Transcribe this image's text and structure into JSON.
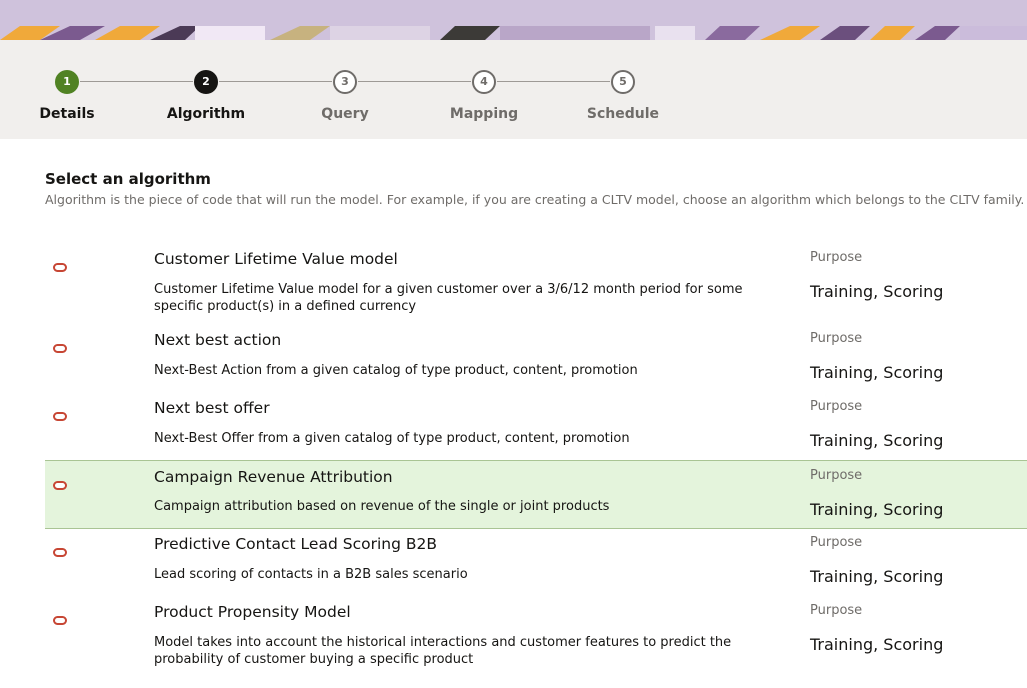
{
  "stepper": {
    "steps": [
      {
        "number": "1",
        "label": "Details",
        "state": "done"
      },
      {
        "number": "2",
        "label": "Algorithm",
        "state": "current"
      },
      {
        "number": "3",
        "label": "Query",
        "state": "pending"
      },
      {
        "number": "4",
        "label": "Mapping",
        "state": "pending"
      },
      {
        "number": "5",
        "label": "Schedule",
        "state": "pending"
      }
    ]
  },
  "section": {
    "title": "Select an algorithm",
    "description": "Algorithm is the piece of code that will run the model. For example, if you are creating a CLTV model, choose an algorithm which belongs to the CLTV family."
  },
  "algorithms": [
    {
      "name": "Customer Lifetime Value model",
      "description": "Customer Lifetime Value model for a given customer over a 3/6/12 month period for some specific product(s) in a defined currency",
      "purpose_label": "Purpose",
      "purpose": "Training, Scoring",
      "selected": false
    },
    {
      "name": "Next best action",
      "description": "Next-Best Action from a given catalog of type product, content, promotion",
      "purpose_label": "Purpose",
      "purpose": "Training, Scoring",
      "selected": false
    },
    {
      "name": "Next best offer",
      "description": "Next-Best Offer from a given catalog of type product, content, promotion",
      "purpose_label": "Purpose",
      "purpose": "Training, Scoring",
      "selected": false
    },
    {
      "name": "Campaign Revenue Attribution",
      "description": "Campaign attribution based on revenue of the single or joint products",
      "purpose_label": "Purpose",
      "purpose": "Training, Scoring",
      "selected": true
    },
    {
      "name": "Predictive Contact Lead Scoring B2B",
      "description": "Lead scoring of contacts in a B2B sales scenario",
      "purpose_label": "Purpose",
      "purpose": "Training, Scoring",
      "selected": false
    },
    {
      "name": "Product Propensity Model",
      "description": "Model takes into account the historical interactions and customer features to predict the probability of customer buying a specific product",
      "purpose_label": "Purpose",
      "purpose": "Training, Scoring",
      "selected": false
    }
  ],
  "colors": {
    "done_step": "#508223",
    "current_step": "#161513",
    "selected_row": "#e4f4dc",
    "radio": "#c74634"
  },
  "icons": {
    "banner": "decorative-banner",
    "radio": "radio-button-icon"
  }
}
